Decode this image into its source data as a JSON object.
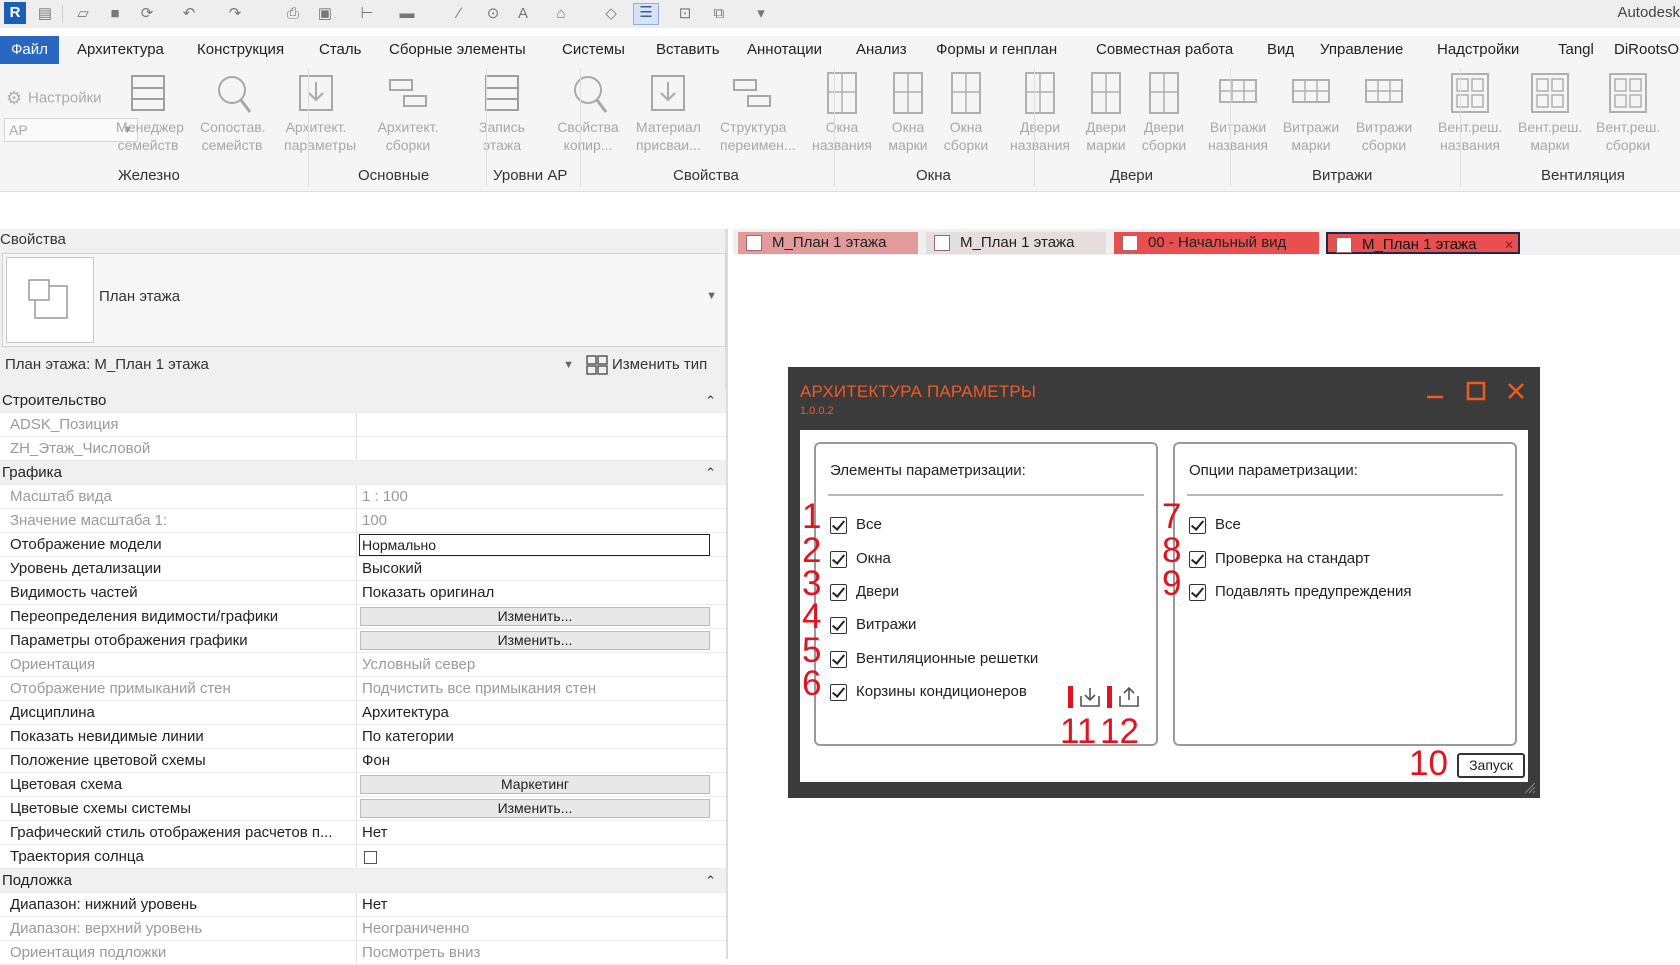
{
  "app": {
    "logo": "R",
    "title": "Autodesk"
  },
  "ribbon_tabs": [
    "Файл",
    "Архитектура",
    "Конструкция",
    "Сталь",
    "Сборные элементы",
    "Системы",
    "Вставить",
    "Аннотации",
    "Анализ",
    "Формы и генплан",
    "Совместная работа",
    "Вид",
    "Управление",
    "Надстройки",
    "Tangl",
    "DiRootsO"
  ],
  "ribbon": {
    "settings_label": "Настройки",
    "ar_combo_value": "АР",
    "buttons": [
      {
        "l1": "Менеджер",
        "l2": "семейств",
        "icon": "family-manager-icon"
      },
      {
        "l1": "Сопостав.",
        "l2": "семейств",
        "icon": "family-compare-icon"
      },
      {
        "l1": "Архитект.",
        "l2": "параметры",
        "icon": "arch-params-icon"
      },
      {
        "l1": "Архитект.",
        "l2": "сборки",
        "icon": "arch-assembly-icon"
      },
      {
        "l1": "Запись",
        "l2": "этажа",
        "icon": "floor-record-icon"
      },
      {
        "l1": "Свойства",
        "l2": "копир...",
        "icon": "copy-properties-icon"
      },
      {
        "l1": "Материал",
        "l2": "присваи...",
        "icon": "material-assign-icon"
      },
      {
        "l1": "Структура",
        "l2": "переимен...",
        "icon": "structure-rename-icon"
      },
      {
        "l1": "Окна",
        "l2": "названия",
        "icon": "window-names-icon"
      },
      {
        "l1": "Окна",
        "l2": "марки",
        "icon": "window-marks-icon"
      },
      {
        "l1": "Окна",
        "l2": "сборки",
        "icon": "window-assembly-icon"
      },
      {
        "l1": "Двери",
        "l2": "названия",
        "icon": "door-names-icon"
      },
      {
        "l1": "Двери",
        "l2": "марки",
        "icon": "door-marks-icon"
      },
      {
        "l1": "Двери",
        "l2": "сборки",
        "icon": "door-assembly-icon"
      },
      {
        "l1": "Витражи",
        "l2": "названия",
        "icon": "curtain-names-icon"
      },
      {
        "l1": "Витражи",
        "l2": "марки",
        "icon": "curtain-marks-icon"
      },
      {
        "l1": "Витражи",
        "l2": "сборки",
        "icon": "curtain-assembly-icon"
      },
      {
        "l1": "Вент.реш.",
        "l2": "названия",
        "icon": "vent-names-icon"
      },
      {
        "l1": "Вент.реш.",
        "l2": "марки",
        "icon": "vent-marks-icon"
      },
      {
        "l1": "Вент.реш.",
        "l2": "сборки",
        "icon": "vent-assembly-icon"
      }
    ],
    "groups": [
      "Железно",
      "Основные",
      "Уровни АР",
      "Свойства",
      "Окна",
      "Двери",
      "Витражи",
      "Вентиляция"
    ]
  },
  "properties": {
    "title": "Свойства",
    "type_name": "План этажа",
    "instance": "План этажа: М_План 1 этажа",
    "edit_type": "Изменить тип",
    "rows": [
      {
        "kind": "section",
        "name": "Строительство"
      },
      {
        "kind": "dim",
        "name": "ADSK_Позиция",
        "value": ""
      },
      {
        "kind": "dim",
        "name": "ZH_Этаж_Числовой",
        "value": ""
      },
      {
        "kind": "section",
        "name": "Графика"
      },
      {
        "kind": "dim",
        "name": "Масштаб вида",
        "value": "1 : 100"
      },
      {
        "kind": "dim",
        "name": "Значение масштаба    1:",
        "value": "100"
      },
      {
        "kind": "input",
        "name": "Отображение модели",
        "value": "Нормально"
      },
      {
        "kind": "text",
        "name": "Уровень детализации",
        "value": "Высокий"
      },
      {
        "kind": "text",
        "name": "Видимость частей",
        "value": "Показать оригинал"
      },
      {
        "kind": "button",
        "name": "Переопределения видимости/графики",
        "value": "Изменить..."
      },
      {
        "kind": "button",
        "name": "Параметры отображения графики",
        "value": "Изменить..."
      },
      {
        "kind": "dim",
        "name": "Ориентация",
        "value": "Условный север"
      },
      {
        "kind": "dim",
        "name": "Отображение примыканий стен",
        "value": "Подчистить все примыкания стен"
      },
      {
        "kind": "text",
        "name": "Дисциплина",
        "value": "Архитектура"
      },
      {
        "kind": "text",
        "name": "Показать невидимые линии",
        "value": "По категории"
      },
      {
        "kind": "text",
        "name": "Положение цветовой схемы",
        "value": "Фон"
      },
      {
        "kind": "button",
        "name": "Цветовая схема",
        "value": "Маркетинг"
      },
      {
        "kind": "button",
        "name": "Цветовые схемы системы",
        "value": "Изменить..."
      },
      {
        "kind": "text",
        "name": "Графический стиль отображения расчетов п...",
        "value": "Нет"
      },
      {
        "kind": "check",
        "name": "Траектория солнца",
        "value": ""
      },
      {
        "kind": "section",
        "name": "Подложка"
      },
      {
        "kind": "text",
        "name": "Диапазон: нижний уровень",
        "value": "Нет"
      },
      {
        "kind": "dim",
        "name": "Диапазон: верхний уровень",
        "value": "Неограниченно"
      },
      {
        "kind": "dim",
        "name": "Ориентация подложки",
        "value": "Посмотреть вниз"
      }
    ]
  },
  "view_tabs": [
    "М_План 1 этажа",
    "М_План 1 этажа",
    "00 - Начальный вид",
    "М_План 1 этажа"
  ],
  "dialog": {
    "title": "АРХИТЕКТУРА ПАРАМЕТРЫ",
    "version": "1.0.0.2",
    "elements_title": "Элементы параметризации:",
    "options_title": "Опции параметризации:",
    "elements": [
      "Все",
      "Окна",
      "Двери",
      "Витражи",
      "Вентиляционные решетки",
      "Корзины кондиционеров"
    ],
    "options": [
      "Все",
      "Проверка на стандарт",
      "Подавлять предупреждения"
    ],
    "run_label": "Запуск",
    "markers": [
      "1",
      "2",
      "3",
      "4",
      "5",
      "6",
      "7",
      "8",
      "9",
      "10",
      "11",
      "12"
    ],
    "accent_color": "#f15a22",
    "marker_color": "#e0141e"
  }
}
